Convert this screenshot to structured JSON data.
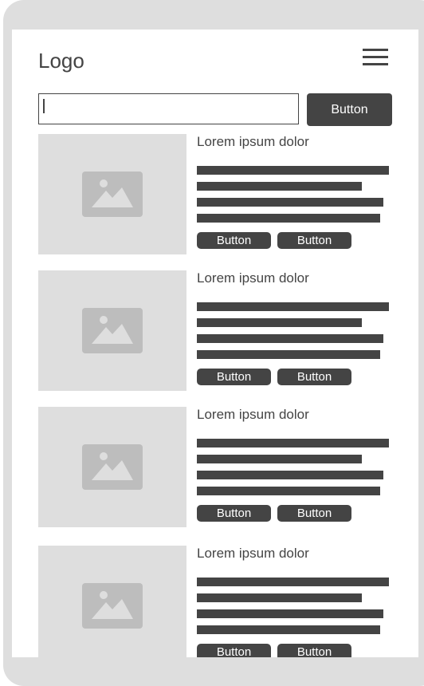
{
  "header": {
    "logo_text": "Logo",
    "menu_icon": "hamburger-menu-icon"
  },
  "search": {
    "value": "",
    "placeholder": "",
    "button_label": "Button"
  },
  "cards": [
    {
      "title": "Lorem ipsum dolor",
      "image_icon": "image-placeholder-icon",
      "button_1": "Button",
      "button_2": "Button"
    },
    {
      "title": "Lorem ipsum dolor",
      "image_icon": "image-placeholder-icon",
      "button_1": "Button",
      "button_2": "Button"
    },
    {
      "title": "Lorem ipsum dolor",
      "image_icon": "image-placeholder-icon",
      "button_1": "Button",
      "button_2": "Button"
    },
    {
      "title": "Lorem ipsum dolor",
      "image_icon": "image-placeholder-icon",
      "button_1": "Button",
      "button_2": "Button"
    }
  ],
  "colors": {
    "dark": "#444444",
    "placeholder_bg": "#dedede",
    "placeholder_icon": "#bdbdbd",
    "device_frame": "#dedede"
  }
}
